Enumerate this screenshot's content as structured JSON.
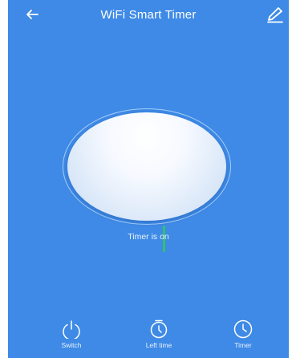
{
  "header": {
    "title": "WiFi Smart Timer",
    "back_icon": "arrow-left-icon",
    "edit_icon": "pencil-icon"
  },
  "dial": {
    "status_text": "Timer is on",
    "indicator_color": "#33c16f"
  },
  "bottom_bar": {
    "items": [
      {
        "label": "Switch",
        "icon": "power-icon"
      },
      {
        "label": "Left time",
        "icon": "stopwatch-icon"
      },
      {
        "label": "Timer",
        "icon": "clock-icon"
      }
    ]
  },
  "colors": {
    "background": "#3e8ae6",
    "text": "#ffffff"
  }
}
